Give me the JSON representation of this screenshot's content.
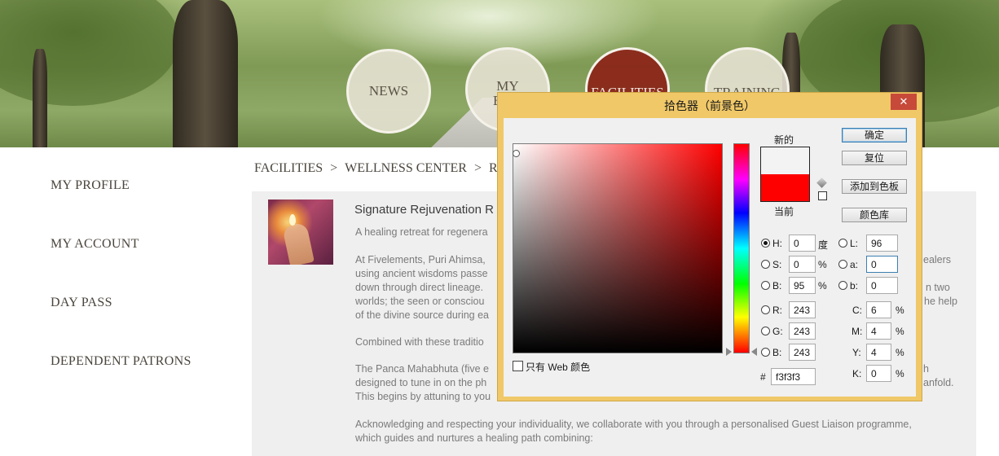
{
  "nav": {
    "items": [
      {
        "label": "NEWS"
      },
      {
        "label": "MY\nBOO"
      },
      {
        "label": "FACILITIES"
      },
      {
        "label": "TRAINING"
      }
    ]
  },
  "sidebar": {
    "items": [
      {
        "label": "MY PROFILE"
      },
      {
        "label": "MY ACCOUNT"
      },
      {
        "label": "DAY PASS"
      },
      {
        "label": "DEPENDENT PATRONS"
      }
    ]
  },
  "breadcrumb": {
    "items": [
      "FACILITIES",
      "WELLNESS CENTER",
      "RE"
    ],
    "separator": ">"
  },
  "content": {
    "title": "Signature Rejuvenation R",
    "lines": [
      "A healing retreat for regenera",
      "At Fivelements, Puri Ahimsa,",
      "using ancient wisdoms passe",
      "down through direct lineage.",
      "worlds; the seen or consciou",
      "of the divine source during ea",
      "Combined with these traditio",
      "The Panca Mahabhuta (five e",
      "designed to tune in on the ph",
      "This begins by attuning to you",
      "Acknowledging and respecting your individuality, we collaborate with you through a personalised Guest Liaison programme,",
      "which guides and nurtures a healing path combining:"
    ],
    "right_fragments": [
      "ealers",
      "n two",
      "he help",
      "h",
      "anfold."
    ]
  },
  "color_picker": {
    "title": "拾色器（前景色）",
    "close_label": "✕",
    "new_label": "新的",
    "current_label": "当前",
    "new_color": "#f3f3f3",
    "current_color": "#ff0000",
    "buttons": {
      "ok": "确定",
      "reset": "复位",
      "add_swatch": "添加到色板",
      "libraries": "颜色库"
    },
    "web_only_label": "只有 Web 颜色",
    "hsb": {
      "h": "0",
      "s": "0",
      "b": "95",
      "h_unit": "度",
      "s_unit": "%",
      "b_unit": "%"
    },
    "rgb": {
      "r": "243",
      "g": "243",
      "b": "243"
    },
    "lab": {
      "l": "96",
      "a": "0",
      "b": "0"
    },
    "cmyk": {
      "c": "6",
      "m": "4",
      "y": "4",
      "k": "0",
      "unit": "%"
    },
    "hex": "f3f3f3",
    "labels": {
      "H": "H:",
      "S": "S:",
      "B": "B:",
      "R": "R:",
      "G": "G:",
      "B2": "B:",
      "L": "L:",
      "a": "a:",
      "b": "b:",
      "C": "C:",
      "M": "M:",
      "Y": "Y:",
      "K": "K:",
      "hash": "#"
    },
    "selected_channel": "H"
  }
}
